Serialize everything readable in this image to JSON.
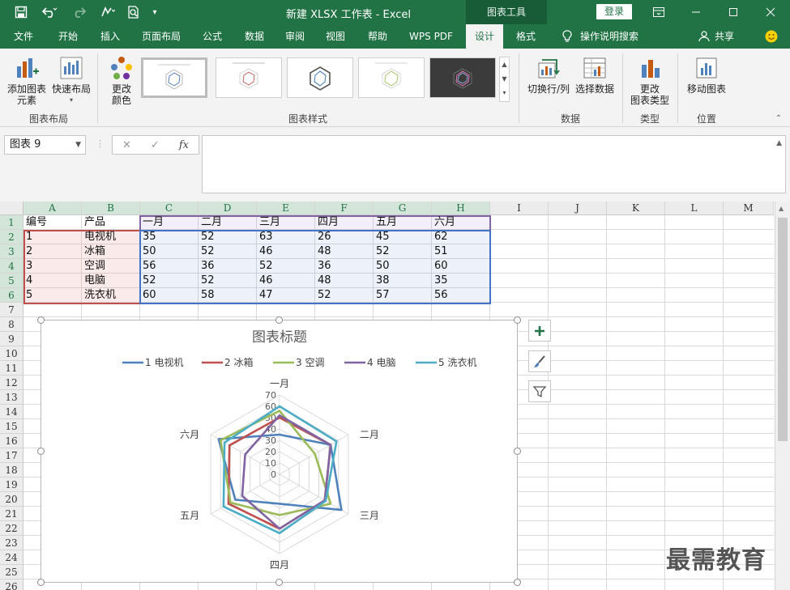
{
  "titlebar": {
    "doc_title": "新建 XLSX 工作表  -  Excel",
    "context_label": "图表工具",
    "login_label": "登录",
    "icons": [
      "save-icon",
      "undo-icon",
      "redo-icon",
      "format-painter-icon",
      "print-preview-icon",
      "customize-qat-icon",
      "ribbon-display-icon",
      "minimize-icon",
      "maximize-icon",
      "close-icon"
    ]
  },
  "tabs": {
    "file": "文件",
    "home": "开始",
    "insert": "插入",
    "layout": "页面布局",
    "formulas": "公式",
    "data": "数据",
    "review": "审阅",
    "view": "视图",
    "help": "帮助",
    "wps": "WPS PDF",
    "design": "设计",
    "format": "格式",
    "tell_me": "操作说明搜索",
    "share": "共享"
  },
  "ribbon": {
    "add_element": "添加图表\n元素",
    "quick_layout": "快速布局",
    "change_colors": "更改\n颜色",
    "group_layouts": "图表布局",
    "group_styles": "图表样式",
    "switch_row_col": "切换行/列",
    "select_data": "选择数据",
    "group_data": "数据",
    "change_type": "更改\n图表类型",
    "group_type": "类型",
    "move_chart": "移动图表",
    "group_location": "位置"
  },
  "formula_bar": {
    "name_box": "图表 9",
    "fx": "fx",
    "value": ""
  },
  "sheet": {
    "columns": [
      "A",
      "B",
      "C",
      "D",
      "E",
      "F",
      "G",
      "H",
      "I",
      "J",
      "K",
      "L",
      "M"
    ],
    "rows": [
      "1",
      "2",
      "3",
      "4",
      "5",
      "6",
      "7",
      "8",
      "9",
      "10",
      "11",
      "12",
      "13",
      "14",
      "15",
      "16",
      "17",
      "18",
      "19",
      "20",
      "21",
      "22",
      "23",
      "24",
      "25",
      "26"
    ],
    "table": [
      [
        "编号",
        "产品",
        "一月",
        "二月",
        "三月",
        "四月",
        "五月",
        "六月"
      ],
      [
        "1",
        "电视机",
        "35",
        "52",
        "63",
        "26",
        "45",
        "62"
      ],
      [
        "2",
        "冰箱",
        "50",
        "52",
        "46",
        "48",
        "52",
        "51"
      ],
      [
        "3",
        "空调",
        "56",
        "36",
        "52",
        "36",
        "50",
        "60"
      ],
      [
        "4",
        "电脑",
        "52",
        "52",
        "46",
        "48",
        "38",
        "35"
      ],
      [
        "5",
        "洗衣机",
        "60",
        "58",
        "47",
        "52",
        "57",
        "56"
      ]
    ]
  },
  "chart_data": {
    "type": "radar",
    "title": "图表标题",
    "categories": [
      "一月",
      "二月",
      "三月",
      "四月",
      "五月",
      "六月"
    ],
    "series": [
      {
        "name": "1 电视机",
        "color": "#4f81bd",
        "values": [
          35,
          52,
          63,
          26,
          45,
          62
        ]
      },
      {
        "name": "2 冰箱",
        "color": "#c0504d",
        "values": [
          50,
          52,
          46,
          48,
          52,
          51
        ]
      },
      {
        "name": "3 空调",
        "color": "#9bbb59",
        "values": [
          56,
          36,
          52,
          36,
          50,
          60
        ]
      },
      {
        "name": "4 电脑",
        "color": "#8064a2",
        "values": [
          52,
          52,
          46,
          48,
          38,
          35
        ]
      },
      {
        "name": "5 洗衣机",
        "color": "#4bacc6",
        "values": [
          60,
          58,
          47,
          52,
          57,
          56
        ]
      }
    ],
    "ticks": [
      "0",
      "10",
      "20",
      "30",
      "40",
      "50",
      "60",
      "70"
    ],
    "rmax": 70,
    "legend_position": "top"
  },
  "watermark": "最需教育",
  "colors": {
    "accent": "#217346",
    "accent_dark": "#185c37"
  }
}
